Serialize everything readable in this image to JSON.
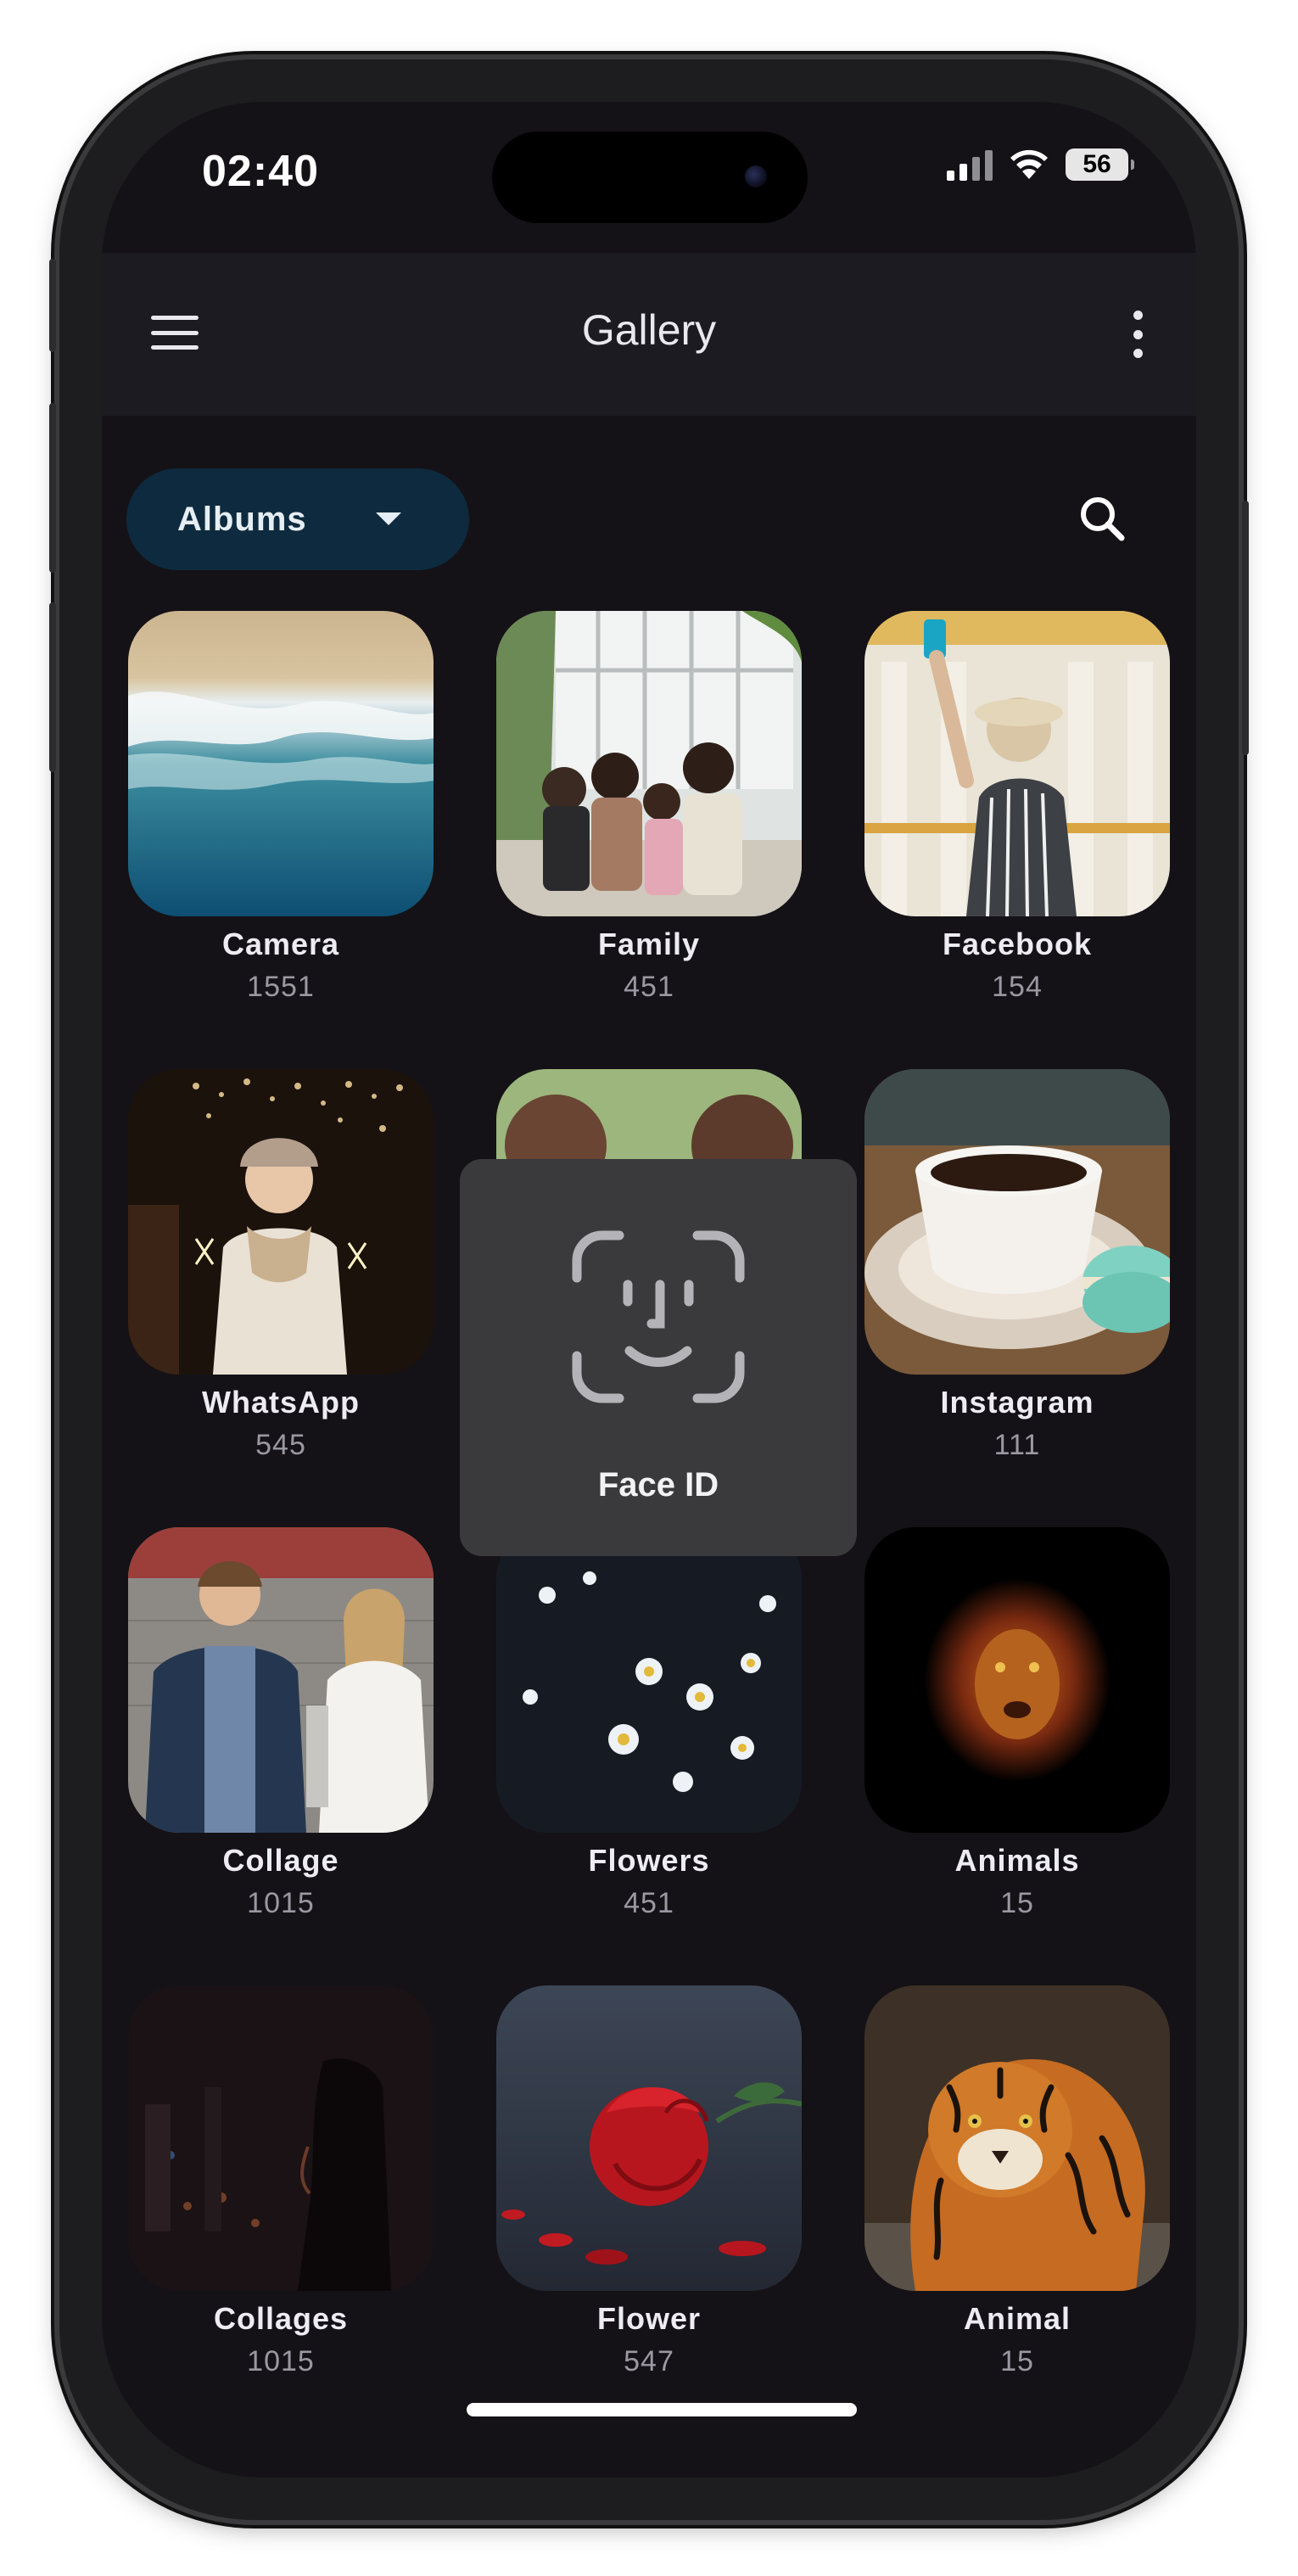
{
  "status_bar": {
    "time": "02:40",
    "battery": "56"
  },
  "app_bar": {
    "title": "Gallery"
  },
  "albums_selector": {
    "label": "Albums"
  },
  "albums": [
    {
      "name": "Camera",
      "count": "1551"
    },
    {
      "name": "Family",
      "count": "451"
    },
    {
      "name": "Facebook",
      "count": "154"
    },
    {
      "name": "WhatsApp",
      "count": "545"
    },
    {
      "name": "",
      "count": ""
    },
    {
      "name": "Instagram",
      "count": "111"
    },
    {
      "name": "Collage",
      "count": "1015"
    },
    {
      "name": "Flowers",
      "count": "451"
    },
    {
      "name": "Animals",
      "count": "15"
    },
    {
      "name": "Collages",
      "count": "1015"
    },
    {
      "name": "Flower",
      "count": "547"
    },
    {
      "name": "Animal",
      "count": "15"
    }
  ],
  "face_id_overlay": {
    "label": "Face ID"
  },
  "colors": {
    "background": "#141216",
    "app_bar": "#1c1b22",
    "chip": "#0e2a3e",
    "overlay": "#3a3a3c"
  }
}
